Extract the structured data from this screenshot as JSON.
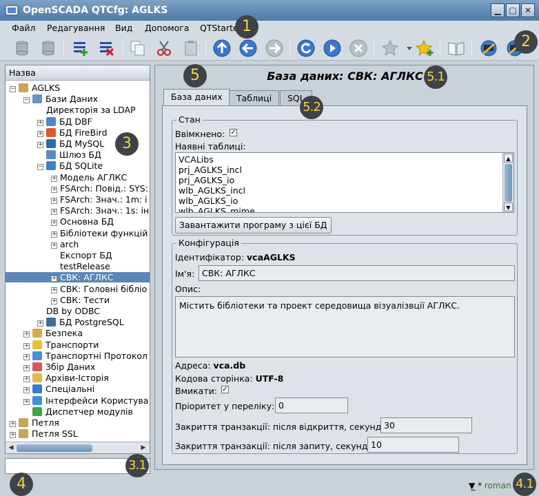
{
  "window": {
    "title": "OpenSCADA QTCfg: AGLKS"
  },
  "menu": [
    {
      "label": "Файл"
    },
    {
      "label": "Редагування"
    },
    {
      "label": "Вид"
    },
    {
      "label": "Допомога"
    },
    {
      "label": "QTStarter"
    }
  ],
  "toolbar_icons": [
    "db-load-icon",
    "db-save-icon",
    "add-item-icon",
    "delete-item-icon",
    "copy-icon",
    "cut-icon",
    "paste-icon",
    "level-up-icon",
    "back-icon",
    "forward-icon",
    "refresh-icon",
    "start-icon",
    "stop-icon",
    "favorite-icon",
    "add-favorite-icon",
    "manual-icon",
    "config-icon-1",
    "config-icon-2"
  ],
  "tree": {
    "header": "Назва",
    "items": [
      {
        "label": "AGLKS",
        "depth": 0,
        "exp": "−",
        "icon": "folder-icon",
        "color": "#c9a55a"
      },
      {
        "label": "Бази Даних",
        "depth": 1,
        "exp": "−",
        "icon": "database-icon",
        "color": "#6a93c4"
      },
      {
        "label": "Директорія за LDAP",
        "depth": 2,
        "exp": "",
        "icon": "",
        "color": ""
      },
      {
        "label": "БД DBF",
        "depth": 2,
        "exp": "+",
        "icon": "dbf-icon",
        "color": "#4d86c9"
      },
      {
        "label": "БД FireBird",
        "depth": 2,
        "exp": "+",
        "icon": "firebird-icon",
        "color": "#e0592a"
      },
      {
        "label": "БД MySQL",
        "depth": 2,
        "exp": "+",
        "icon": "mysql-icon",
        "color": "#2e6aa6"
      },
      {
        "label": "Шлюз БД",
        "depth": 2,
        "exp": "",
        "icon": "gateway-icon",
        "color": "#5d8ac4"
      },
      {
        "label": "БД SQLite",
        "depth": 2,
        "exp": "−",
        "icon": "sqlite-icon",
        "color": "#3c7fc9"
      },
      {
        "label": "Модель АГЛКС",
        "depth": 3,
        "exp": "+",
        "icon": "",
        "color": ""
      },
      {
        "label": "FSArch: Повід.: SYS:",
        "depth": 3,
        "exp": "+",
        "icon": "",
        "color": ""
      },
      {
        "label": "FSArch: Знач.: 1m: і",
        "depth": 3,
        "exp": "+",
        "icon": "",
        "color": ""
      },
      {
        "label": "FSArch: Знач.: 1s: ін",
        "depth": 3,
        "exp": "+",
        "icon": "",
        "color": ""
      },
      {
        "label": "Основна БД",
        "depth": 3,
        "exp": "+",
        "icon": "",
        "color": ""
      },
      {
        "label": "Бібліотеки функцій",
        "depth": 3,
        "exp": "+",
        "icon": "",
        "color": ""
      },
      {
        "label": "arch",
        "depth": 3,
        "exp": "+",
        "icon": "",
        "color": ""
      },
      {
        "label": "Експорт БД",
        "depth": 3,
        "exp": "",
        "icon": "",
        "color": ""
      },
      {
        "label": "testRelease",
        "depth": 3,
        "exp": "",
        "icon": "",
        "color": ""
      },
      {
        "label": "СВК: АГЛКС",
        "depth": 3,
        "exp": "+",
        "icon": "",
        "color": "",
        "selected": true
      },
      {
        "label": "СВК: Головні бібліо",
        "depth": 3,
        "exp": "+",
        "icon": "",
        "color": ""
      },
      {
        "label": "СВК: Тести",
        "depth": 3,
        "exp": "+",
        "icon": "",
        "color": ""
      },
      {
        "label": "DB by ODBC",
        "depth": 2,
        "exp": "",
        "icon": "",
        "color": ""
      },
      {
        "label": "БД PostgreSQL",
        "depth": 2,
        "exp": "+",
        "icon": "postgresql-icon",
        "color": "#3d6d9a"
      },
      {
        "label": "Безпека",
        "depth": 1,
        "exp": "+",
        "icon": "security-icon",
        "color": "#d9a94a"
      },
      {
        "label": "Транспорти",
        "depth": 1,
        "exp": "+",
        "icon": "transport-icon",
        "color": "#e8c13a"
      },
      {
        "label": "Транспортні Протокол",
        "depth": 1,
        "exp": "+",
        "icon": "protocol-icon",
        "color": "#4b8fd6"
      },
      {
        "label": "Збір Даних",
        "depth": 1,
        "exp": "+",
        "icon": "daq-icon",
        "color": "#d25a5a"
      },
      {
        "label": "Архіви-Історія",
        "depth": 1,
        "exp": "+",
        "icon": "archive-icon",
        "color": "#e6b84a"
      },
      {
        "label": "Спеціальні",
        "depth": 1,
        "exp": "+",
        "icon": "special-icon",
        "color": "#3a7ad0"
      },
      {
        "label": "Інтерфейси Користува",
        "depth": 1,
        "exp": "+",
        "icon": "ui-icon",
        "color": "#3f8ed8"
      },
      {
        "label": "Диспетчер модулів",
        "depth": 1,
        "exp": "",
        "icon": "modules-icon",
        "color": "#3ba64b"
      },
      {
        "label": "Петля",
        "depth": 0,
        "exp": "+",
        "icon": "folder-icon",
        "color": "#c9a55a"
      },
      {
        "label": "Петля SSL",
        "depth": 0,
        "exp": "+",
        "icon": "folder-icon",
        "color": "#c9a55a"
      }
    ]
  },
  "page": {
    "title": "База даних: СВК: АГЛКС",
    "tabs": [
      {
        "label": "База даних",
        "active": true
      },
      {
        "label": "Таблиці",
        "active": false
      },
      {
        "label": "SQL",
        "active": false
      }
    ],
    "state": {
      "legend": "Стан",
      "enabled_label": "Ввімкнено:",
      "enabled": true,
      "tables_label": "Наявні таблиці:",
      "tables": [
        "VCALibs",
        "prj_AGLKS_incl",
        "prj_AGLKS_io",
        "wlb_AGLKS_incl",
        "wlb_AGLKS_io",
        "wlb_AGLKS_mime"
      ],
      "load_button": "Завантажити програму з цієї БД"
    },
    "config": {
      "legend": "Конфігурація",
      "id_label": "Ідентифікатор:",
      "id_value": "vcaAGLKS",
      "name_label": "Ім'я:",
      "name_value": "СВК: АГЛКС",
      "descr_label": "Опис:",
      "descr_value": "Містить бібліотеки та проект середовища візуалізвції АГЛКС.",
      "addr_label": "Адреса:",
      "addr_value": "vca.db",
      "codepage_label": "Кодова сторінка:",
      "codepage_value": "UTF-8",
      "to_enable_label": "Вмикати:",
      "to_enable": true,
      "priority_label": "Пріоритет у переліку:",
      "priority_value": "0",
      "trans_open_label": "Закриття транзакції: після відкриття, секунд:",
      "trans_open_value": "30",
      "trans_req_label": "Закриття транзакції: після запиту, секунд:",
      "trans_req_value": "10"
    }
  },
  "status": {
    "mode_mark": "*",
    "user": "roman"
  },
  "markers": [
    "1",
    "2",
    "3",
    "3.1",
    "4",
    "4.1",
    "5",
    "5.1",
    "5.2"
  ],
  "colors": {
    "selection": "#5a87b5",
    "marker_bg": "#3f4246",
    "marker_fg": "#f0d44a"
  }
}
